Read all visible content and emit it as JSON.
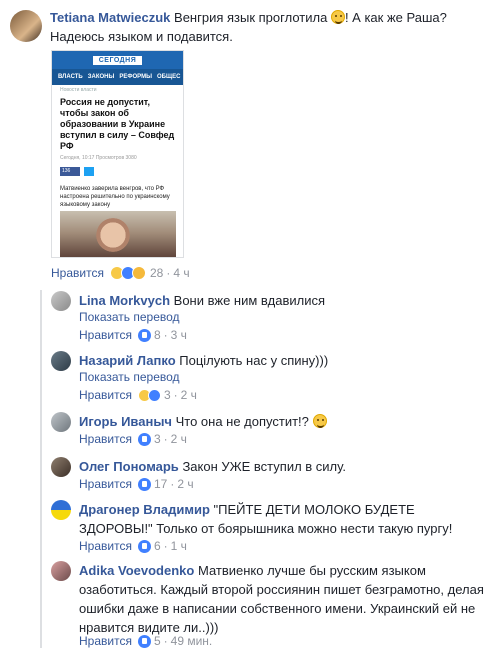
{
  "top_comment": {
    "author": "Tetiana Matwieczuk",
    "text_before_emoji": "Венгрия язык проглотила",
    "text_after_emoji": "! А как же Раша? Надеюсь языком и подавится.",
    "like_label": "Нравится",
    "reaction_count": "28",
    "time": "4 ч"
  },
  "article_card": {
    "logo": "СЕГОДНЯ",
    "nav": [
      "ВЛАСТЬ",
      "ЗАКОНЫ",
      "РЕФОРМЫ",
      "ОБЩЕС"
    ],
    "section": "Новости власти",
    "title": "Россия не допустит, чтобы закон об образовании в Украине вступил в силу – Совфед РФ",
    "meta": "Сегодня, 10:17   Просмотров 3080",
    "share_count": "136",
    "lead": "Матвиенко заверила венгров, что РФ настроена решительно по украинскому языковому закону"
  },
  "replies": [
    {
      "author": "Lina Morkvych",
      "text": "Вони вже ним вдавилися",
      "translate": "Показать перевод",
      "like_label": "Нравится",
      "count": "8",
      "time": "3 ч"
    },
    {
      "author": "Назарий Лапко",
      "text": "Поцілують нас у спину)))",
      "translate": "Показать перевод",
      "like_label": "Нравится",
      "count": "3",
      "time": "2 ч"
    },
    {
      "author": "Игорь Иваныч",
      "text": "Что она не допустит!?",
      "like_label": "Нравится",
      "count": "3",
      "time": "2 ч"
    },
    {
      "author": "Олег Пономарь",
      "text": "Закон УЖЕ вступил в силу.",
      "like_label": "Нравится",
      "count": "17",
      "time": "2 ч"
    },
    {
      "author": "Драгонер Владимир",
      "text": "\"ПЕЙТЕ ДЕТИ МОЛОКО БУДЕТЕ ЗДОРОВЫ!\" Только от боярышника можно нести такую пургу!",
      "like_label": "Нравится",
      "count": "6",
      "time": "1 ч"
    },
    {
      "author": "Adika Voevodenko",
      "text": "Матвиенко лучше бы русским языком озаботиться. Каждый второй россиянин пишет безграмотно, делая ошибки даже в написании собственного имени. Украинский ей не нравится видите ли..)))",
      "like_label": "Нравится",
      "count": "5",
      "time": "49 мин."
    }
  ],
  "colors": {
    "link": "#365899",
    "meta": "#90949c",
    "like_blue": "#4080ff",
    "card_header": "#1f67b2"
  },
  "icons": [
    "laugh-emoji-icon",
    "like-reaction-icon",
    "wow-reaction-icon",
    "smile-emoji-icon"
  ]
}
